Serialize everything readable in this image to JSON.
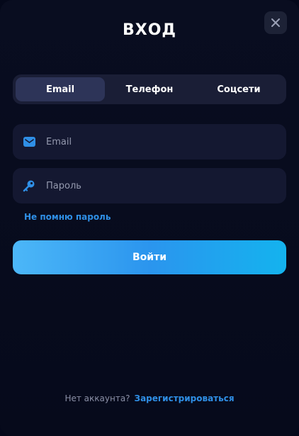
{
  "modal": {
    "title": "ВХОД",
    "close_icon": "close-icon"
  },
  "tabs": [
    {
      "label": "Email",
      "active": true
    },
    {
      "label": "Телефон",
      "active": false
    },
    {
      "label": "Соцсети",
      "active": false
    }
  ],
  "fields": {
    "email": {
      "placeholder": "Email",
      "icon": "mail-icon"
    },
    "password": {
      "placeholder": "Пароль",
      "icon": "key-icon"
    }
  },
  "forgot_label": "Не помню пароль",
  "submit_label": "Войти",
  "footer": {
    "question": "Нет аккаунта?",
    "register_label": "Зарегистрироваться"
  },
  "colors": {
    "background": "#060a1b",
    "accent": "#2f8fe6",
    "button_gradient_start": "#4cb7f8",
    "button_gradient_end": "#14b3ee",
    "field_bg": "#141831",
    "tab_active_bg": "#2d3458"
  }
}
